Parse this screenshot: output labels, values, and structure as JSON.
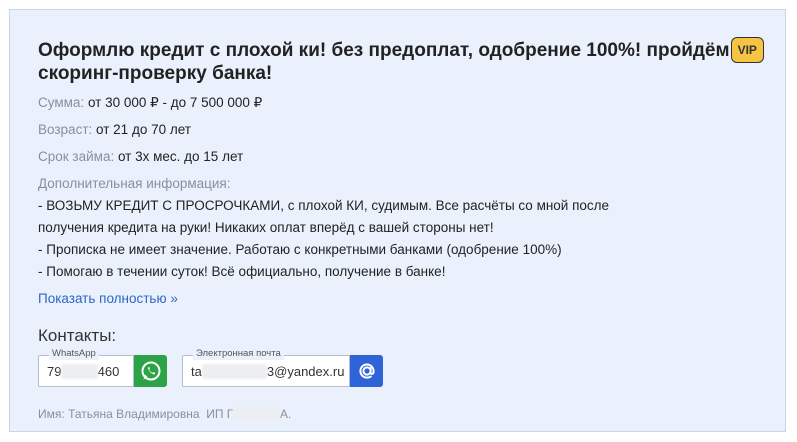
{
  "listing": {
    "title": "Оформлю кредит с плохой ки! без предоплат, одобрение 100%! пройдём",
    "title_cont": "скоринг-проверку банка!",
    "badge": "VIP"
  },
  "details": {
    "amount_label": "Сумма:",
    "amount_value": "от 30 000 ₽ - до 7 500 000 ₽",
    "age_label": "Возраст:",
    "age_value": "от 21 до 70 лет",
    "term_label": "Срок займа:",
    "term_value": "от 3х мес. до 15 лет",
    "info_label": "Дополнительная информация:",
    "info_lines": [
      "- ВОЗЬМУ КРЕДИТ С ПРОСРОЧКАМИ, с плохой КИ, судимым. Все расчёты со мной после",
      "получения кредита на руки! Никаких оплат вперёд с вашей стороны нет!",
      "- Прописка не имеет значение. Работаю с конкретными банками (одобрение 100%)",
      "- Помогаю в течении суток! Всё официально, получение в банке!"
    ],
    "show_more": "Показать полностью »"
  },
  "contacts": {
    "heading": "Контакты:",
    "whatsapp_legend": "WhatsApp",
    "whatsapp_prefix": "79",
    "whatsapp_suffix": "460",
    "email_legend": "Электронная почта",
    "email_prefix": "ta",
    "email_suffix": "3@yandex.ru",
    "whatsapp_icon": "whatsapp-icon",
    "email_icon": "at-sign-icon",
    "whatsapp_color": "#2ca347",
    "email_color": "#2f63d8"
  },
  "owner": {
    "name_label": "Имя:",
    "name_value": "Татьяна Владимировна",
    "org_prefix": "ИП Г",
    "org_suffix": "А."
  }
}
